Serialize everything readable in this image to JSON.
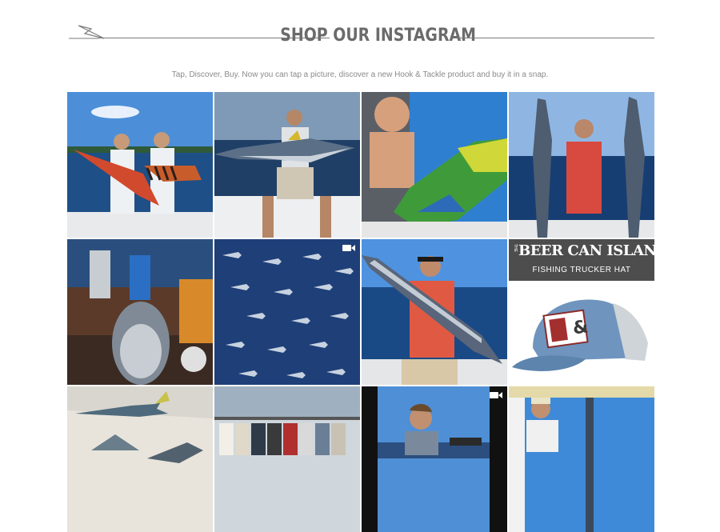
{
  "section": {
    "title": "SHOP OUR INSTAGRAM",
    "subtitle": "Tap, Discover, Buy. Now you can tap a picture, discover a new Hook & Tackle product and buy it in a snap."
  },
  "posts": [
    {
      "name": "instagram-post-snapper-catch"
    },
    {
      "name": "instagram-post-tuna-catch"
    },
    {
      "name": "instagram-post-mahi-catch"
    },
    {
      "name": "instagram-post-wahoo-pair"
    },
    {
      "name": "instagram-post-giant-tuna-deck"
    },
    {
      "name": "instagram-post-fish-pattern",
      "video": true
    },
    {
      "name": "instagram-post-wahoo-sunglasses"
    },
    {
      "name": "instagram-post-beer-can-island-hat"
    },
    {
      "name": "instagram-post-store-mounts"
    },
    {
      "name": "instagram-post-store-racks"
    },
    {
      "name": "instagram-post-angler-portrait",
      "video": true
    },
    {
      "name": "instagram-post-boat-captain"
    }
  ],
  "promo": {
    "brand_line1": "BEER CAN ISLAND",
    "brand_prefix": "THE",
    "brand_line2": "FISHING TRUCKER HAT",
    "hat_logo_a": "BEER",
    "hat_logo_b": "CAN",
    "hat_logo_c": "ISLAND"
  },
  "colors": {
    "heading": "#6b6b6b",
    "rule": "#7a7a7a",
    "subtitle": "#8a8a8a",
    "sky": "#3f86d6",
    "ocean": "#1d3f73",
    "boat_white": "#e9ecef",
    "promo_banner": "#4d4d4d"
  }
}
